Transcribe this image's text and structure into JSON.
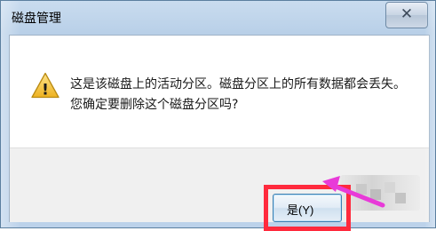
{
  "window": {
    "title": "磁盘管理",
    "close_glyph": "✕"
  },
  "dialog": {
    "message_line1": "这是该磁盘上的活动分区。磁盘分区上的所有数据都会丢失。",
    "message_line2": "您确定要删除这个磁盘分区吗?",
    "warning_icon_glyph": "!"
  },
  "buttons": {
    "yes_label": "是(Y)"
  },
  "colors": {
    "highlight_box": "#ff2a3d",
    "arrow": "#e83ad8",
    "warning_fill": "#f5c542"
  }
}
